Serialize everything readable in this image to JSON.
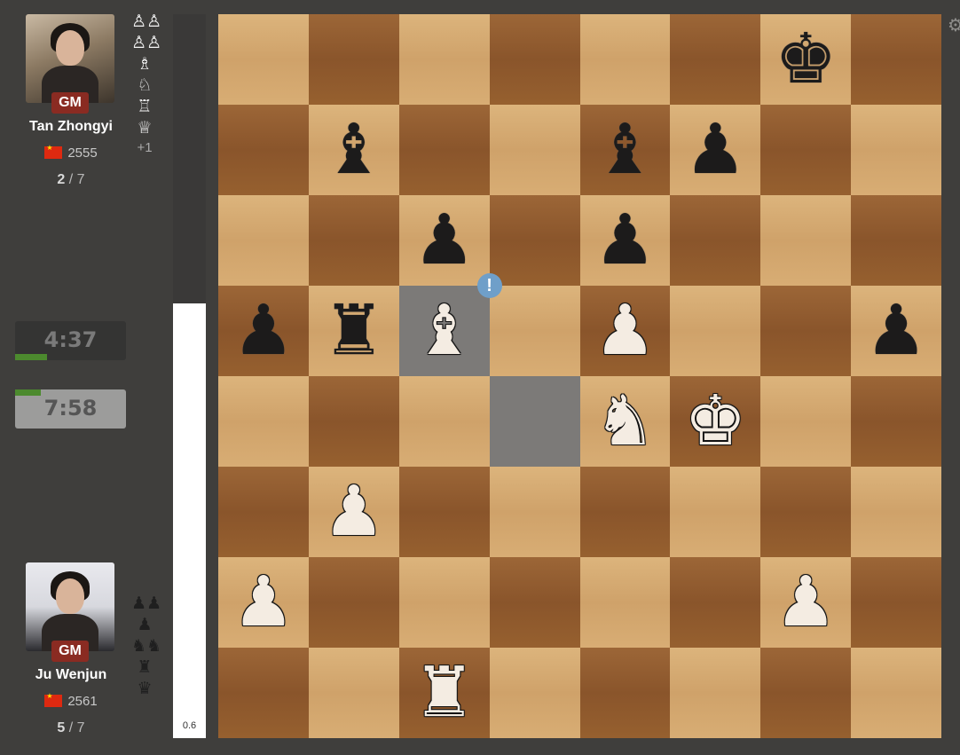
{
  "top_player": {
    "title": "GM",
    "name": "Tan Zhongyi",
    "rating": "2555",
    "score": "2",
    "score_total": "/ 7",
    "captured": [
      "♙♙",
      "♙♙",
      "♗",
      "♘",
      "♖",
      "♕"
    ],
    "material_diff": "+1",
    "clock": "4:37",
    "clock_progress": 0.29
  },
  "bottom_player": {
    "title": "GM",
    "name": "Ju Wenjun",
    "rating": "2561",
    "score": "5",
    "score_total": "/ 7",
    "captured": [
      "♟♟",
      "♟",
      "♞♞",
      "♜",
      "♛"
    ],
    "clock": "7:58",
    "clock_progress": 0.23
  },
  "evaluation": {
    "label": "0.6",
    "white_share": 0.6
  },
  "board": {
    "ranks": [
      [
        "",
        "",
        "",
        "",
        "",
        "",
        "k",
        ""
      ],
      [
        "",
        "b",
        "",
        "",
        "b",
        "p",
        "",
        ""
      ],
      [
        "",
        "",
        "p",
        "",
        "p",
        "",
        "",
        ""
      ],
      [
        "p",
        "r",
        "B",
        "",
        "P",
        "",
        "",
        "p"
      ],
      [
        "",
        "",
        "",
        "",
        "N",
        "K",
        "",
        ""
      ],
      [
        "",
        "P",
        "",
        "",
        "",
        "",
        "",
        ""
      ],
      [
        "P",
        "",
        "",
        "",
        "",
        "",
        "P",
        ""
      ],
      [
        "",
        "",
        "R",
        "",
        "",
        "",
        "",
        ""
      ]
    ],
    "last_move": [
      "c5",
      "d4"
    ],
    "annotation": {
      "square": "c5",
      "symbol": "!"
    }
  },
  "icons": {
    "settings": "gear-icon",
    "flag": "china-flag-icon"
  }
}
